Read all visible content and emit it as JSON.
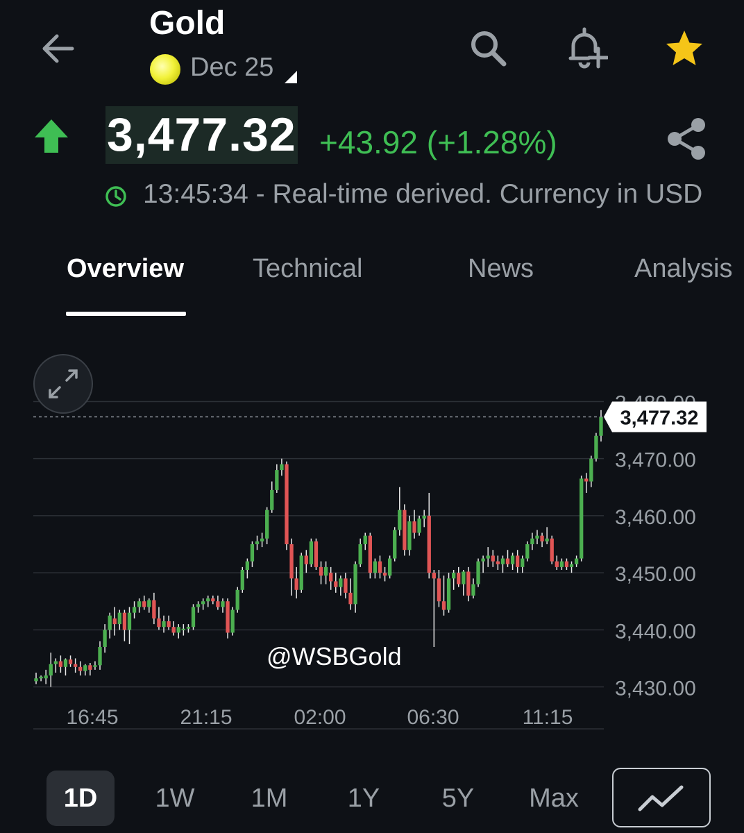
{
  "header": {
    "title": "Gold",
    "contract": "Dec 25"
  },
  "quote": {
    "price": "3,477.32",
    "change": "+43.92 (+1.28%)",
    "status": "13:45:34 - Real-time derived. Currency in USD"
  },
  "tabs": [
    "Overview",
    "Technical",
    "News",
    "Analysis"
  ],
  "ranges": [
    "1D",
    "1W",
    "1M",
    "1Y",
    "5Y",
    "Max"
  ],
  "colors": {
    "background": "#0e1116",
    "up": "#4caf50",
    "down": "#e05555",
    "change_text": "#3fbe54",
    "star": "#f5c518"
  },
  "chart_data": {
    "type": "candlestick",
    "x_ticks": [
      "16:45",
      "21:15",
      "02:00",
      "06:30",
      "11:15"
    ],
    "y_ticks": [
      "3,430.00",
      "3,440.00",
      "3,450.00",
      "3,460.00",
      "3,470.00",
      "3,480.00"
    ],
    "ylim": [
      3428,
      3482
    ],
    "last_price": 3477.32,
    "last_price_label": "3,477.32",
    "watermark": "@WSBGold",
    "candles": [
      [
        3431.0,
        3432.5,
        3430.5,
        3431.5
      ],
      [
        3431.5,
        3432.0,
        3431.0,
        3431.8
      ],
      [
        3431.5,
        3433.0,
        3430.5,
        3432.0
      ],
      [
        3432.0,
        3436.0,
        3430.0,
        3434.0
      ],
      [
        3434.0,
        3435.0,
        3432.5,
        3434.5
      ],
      [
        3434.5,
        3435.5,
        3432.5,
        3433.5
      ],
      [
        3433.5,
        3435.0,
        3432.0,
        3434.8
      ],
      [
        3434.8,
        3435.5,
        3433.5,
        3434.0
      ],
      [
        3434.0,
        3435.0,
        3432.5,
        3433.5
      ],
      [
        3433.5,
        3434.5,
        3432.0,
        3432.8
      ],
      [
        3432.8,
        3434.0,
        3432.0,
        3433.8
      ],
      [
        3433.8,
        3434.2,
        3432.0,
        3433.0
      ],
      [
        3433.5,
        3434.5,
        3433.0,
        3433.8
      ],
      [
        3433.8,
        3438.0,
        3433.0,
        3437.0
      ],
      [
        3437.0,
        3441.0,
        3436.0,
        3440.0
      ],
      [
        3440.0,
        3443.0,
        3438.5,
        3442.5
      ],
      [
        3442.0,
        3444.0,
        3439.0,
        3441.0
      ],
      [
        3441.0,
        3443.5,
        3440.0,
        3443.0
      ],
      [
        3443.0,
        3443.5,
        3438.0,
        3440.0
      ],
      [
        3440.0,
        3444.0,
        3437.5,
        3443.0
      ],
      [
        3443.0,
        3445.0,
        3442.0,
        3444.0
      ],
      [
        3444.0,
        3445.5,
        3443.0,
        3445.0
      ],
      [
        3445.0,
        3446.0,
        3443.5,
        3444.0
      ],
      [
        3444.0,
        3445.5,
        3443.0,
        3445.2
      ],
      [
        3445.2,
        3446.5,
        3441.0,
        3442.0
      ],
      [
        3442.0,
        3444.0,
        3440.0,
        3440.5
      ],
      [
        3440.5,
        3442.5,
        3439.5,
        3441.5
      ],
      [
        3441.5,
        3442.5,
        3440.0,
        3440.5
      ],
      [
        3440.5,
        3441.5,
        3439.0,
        3439.5
      ],
      [
        3439.5,
        3441.0,
        3438.5,
        3440.5
      ],
      [
        3440.0,
        3441.0,
        3439.0,
        3440.2
      ],
      [
        3440.2,
        3441.0,
        3439.5,
        3440.5
      ],
      [
        3440.5,
        3444.5,
        3440.0,
        3444.0
      ],
      [
        3444.0,
        3445.0,
        3443.0,
        3444.5
      ],
      [
        3444.5,
        3445.5,
        3443.5,
        3445.0
      ],
      [
        3445.0,
        3446.0,
        3444.0,
        3445.5
      ],
      [
        3445.5,
        3446.0,
        3444.5,
        3445.0
      ],
      [
        3445.0,
        3446.0,
        3443.5,
        3444.0
      ],
      [
        3444.0,
        3445.5,
        3443.0,
        3445.0
      ],
      [
        3445.0,
        3445.5,
        3438.5,
        3439.5
      ],
      [
        3439.5,
        3444.0,
        3439.0,
        3443.5
      ],
      [
        3443.5,
        3447.5,
        3443.0,
        3447.0
      ],
      [
        3447.0,
        3451.0,
        3446.5,
        3450.5
      ],
      [
        3450.5,
        3452.5,
        3449.0,
        3452.0
      ],
      [
        3452.0,
        3455.5,
        3451.0,
        3455.0
      ],
      [
        3455.0,
        3456.5,
        3454.0,
        3455.5
      ],
      [
        3455.5,
        3457.0,
        3454.5,
        3456.0
      ],
      [
        3456.0,
        3461.5,
        3455.0,
        3461.0
      ],
      [
        3461.0,
        3466.0,
        3460.5,
        3464.5
      ],
      [
        3464.5,
        3469.0,
        3464.0,
        3468.0
      ],
      [
        3468.0,
        3470.0,
        3467.0,
        3469.0
      ],
      [
        3469.0,
        3469.5,
        3454.0,
        3455.0
      ],
      [
        3455.0,
        3456.0,
        3446.0,
        3449.0
      ],
      [
        3449.0,
        3451.0,
        3445.5,
        3447.0
      ],
      [
        3447.0,
        3453.5,
        3446.5,
        3453.0
      ],
      [
        3453.0,
        3454.0,
        3450.0,
        3451.5
      ],
      [
        3451.5,
        3456.0,
        3451.0,
        3455.5
      ],
      [
        3455.5,
        3456.0,
        3450.5,
        3451.0
      ],
      [
        3451.0,
        3452.0,
        3448.0,
        3449.5
      ],
      [
        3449.5,
        3452.0,
        3448.0,
        3451.0
      ],
      [
        3450.0,
        3451.0,
        3447.0,
        3448.5
      ],
      [
        3448.5,
        3450.0,
        3446.5,
        3447.5
      ],
      [
        3447.5,
        3449.5,
        3446.0,
        3449.0
      ],
      [
        3449.0,
        3450.0,
        3445.5,
        3446.5
      ],
      [
        3446.5,
        3449.0,
        3443.5,
        3444.5
      ],
      [
        3444.5,
        3452.0,
        3443.0,
        3451.5
      ],
      [
        3451.5,
        3456.0,
        3451.0,
        3455.0
      ],
      [
        3455.0,
        3457.0,
        3454.0,
        3456.5
      ],
      [
        3456.5,
        3457.0,
        3449.0,
        3450.0
      ],
      [
        3450.0,
        3452.5,
        3449.0,
        3452.0
      ],
      [
        3452.0,
        3453.0,
        3449.0,
        3450.0
      ],
      [
        3450.0,
        3451.0,
        3448.5,
        3449.5
      ],
      [
        3449.5,
        3453.0,
        3449.0,
        3452.5
      ],
      [
        3452.5,
        3458.0,
        3452.0,
        3457.5
      ],
      [
        3457.5,
        3465.0,
        3456.5,
        3461.0
      ],
      [
        3461.0,
        3462.0,
        3453.0,
        3454.0
      ],
      [
        3454.0,
        3460.0,
        3453.0,
        3459.0
      ],
      [
        3459.0,
        3461.0,
        3456.0,
        3457.0
      ],
      [
        3457.0,
        3460.0,
        3456.5,
        3459.5
      ],
      [
        3459.5,
        3461.0,
        3458.0,
        3460.0
      ],
      [
        3460.0,
        3464.0,
        3449.0,
        3450.0
      ],
      [
        3450.0,
        3450.5,
        3437.0,
        3449.0
      ],
      [
        3449.0,
        3450.5,
        3444.0,
        3445.0
      ],
      [
        3445.0,
        3449.5,
        3442.5,
        3443.5
      ],
      [
        3443.5,
        3450.0,
        3443.0,
        3449.0
      ],
      [
        3449.0,
        3450.5,
        3447.0,
        3450.0
      ],
      [
        3450.0,
        3451.0,
        3447.5,
        3448.0
      ],
      [
        3448.0,
        3450.5,
        3446.0,
        3450.2
      ],
      [
        3450.2,
        3451.0,
        3445.0,
        3446.0
      ],
      [
        3446.0,
        3449.0,
        3445.5,
        3448.0
      ],
      [
        3448.0,
        3452.5,
        3447.5,
        3452.0
      ],
      [
        3452.0,
        3453.0,
        3450.0,
        3452.5
      ],
      [
        3452.5,
        3454.5,
        3451.0,
        3453.0
      ],
      [
        3453.0,
        3454.0,
        3451.0,
        3452.0
      ],
      [
        3452.0,
        3453.0,
        3450.5,
        3451.5
      ],
      [
        3451.5,
        3453.0,
        3450.0,
        3452.5
      ],
      [
        3452.5,
        3454.0,
        3451.0,
        3451.5
      ],
      [
        3451.5,
        3453.5,
        3450.5,
        3453.0
      ],
      [
        3453.0,
        3454.0,
        3450.0,
        3451.0
      ],
      [
        3451.0,
        3453.0,
        3450.0,
        3452.5
      ],
      [
        3452.5,
        3455.5,
        3452.0,
        3455.0
      ],
      [
        3455.0,
        3457.0,
        3454.0,
        3456.0
      ],
      [
        3456.0,
        3457.5,
        3455.0,
        3456.5
      ],
      [
        3456.5,
        3457.0,
        3454.5,
        3455.5
      ],
      [
        3455.5,
        3458.0,
        3455.0,
        3456.0
      ],
      [
        3456.0,
        3456.5,
        3451.5,
        3452.0
      ],
      [
        3452.0,
        3453.0,
        3450.5,
        3451.0
      ],
      [
        3451.0,
        3452.5,
        3450.5,
        3452.0
      ],
      [
        3452.0,
        3452.5,
        3450.5,
        3451.0
      ],
      [
        3451.0,
        3452.0,
        3450.0,
        3451.5
      ],
      [
        3451.5,
        3453.0,
        3451.0,
        3452.5
      ],
      [
        3452.5,
        3467.0,
        3452.0,
        3466.5
      ],
      [
        3466.5,
        3467.5,
        3464.0,
        3466.0
      ],
      [
        3466.0,
        3470.5,
        3465.0,
        3470.0
      ],
      [
        3470.0,
        3474.5,
        3469.5,
        3474.0
      ],
      [
        3474.0,
        3478.5,
        3473.0,
        3477.3
      ]
    ]
  }
}
